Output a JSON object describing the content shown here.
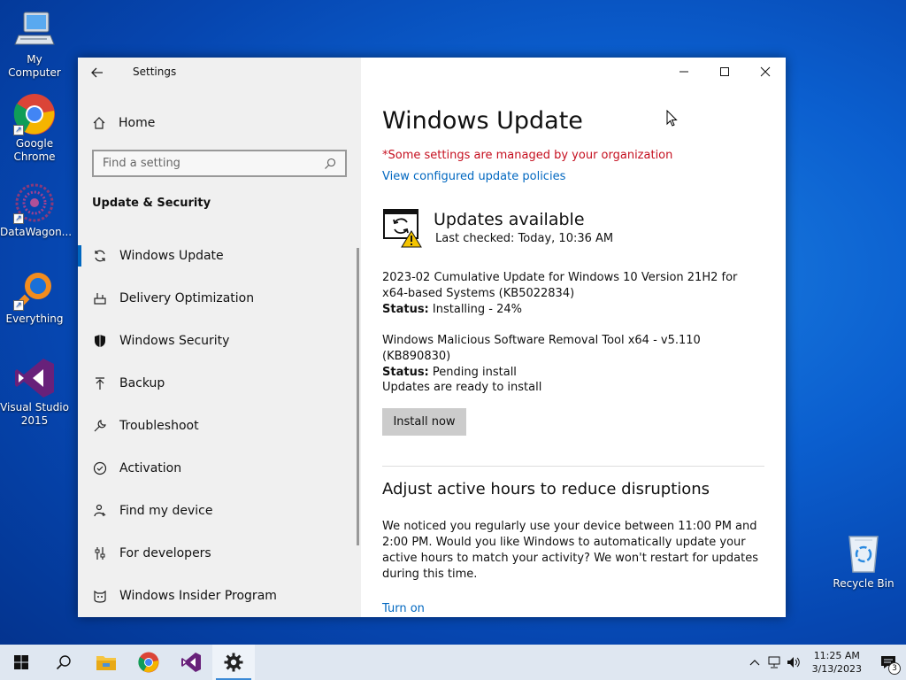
{
  "desktop": {
    "icons": [
      {
        "label": "My Computer",
        "icon": "computer-icon"
      },
      {
        "label": "Google Chrome",
        "icon": "chrome-icon"
      },
      {
        "label": "DataWagon...",
        "icon": "datawagon-icon"
      },
      {
        "label": "Everything",
        "icon": "everything-icon"
      },
      {
        "label": "Visual Studio 2015",
        "icon": "visual-studio-icon"
      }
    ],
    "recycle_bin": "Recycle Bin"
  },
  "window": {
    "app_title": "Settings",
    "sidebar": {
      "home_label": "Home",
      "search_placeholder": "Find a setting",
      "section_title": "Update & Security",
      "items": [
        {
          "label": "Windows Update",
          "icon": "sync-icon",
          "active": true
        },
        {
          "label": "Delivery Optimization",
          "icon": "delivery-optimization-icon"
        },
        {
          "label": "Windows Security",
          "icon": "shield-icon"
        },
        {
          "label": "Backup",
          "icon": "backup-arrow-icon"
        },
        {
          "label": "Troubleshoot",
          "icon": "wrench-icon"
        },
        {
          "label": "Activation",
          "icon": "checkmark-circle-icon"
        },
        {
          "label": "Find my device",
          "icon": "person-location-icon"
        },
        {
          "label": "For developers",
          "icon": "developer-sliders-icon"
        },
        {
          "label": "Windows Insider Program",
          "icon": "insider-cat-icon"
        }
      ]
    },
    "main": {
      "title": "Windows Update",
      "managed_notice": "*Some settings are managed by your organization",
      "policies_link": "View configured update policies",
      "status_title": "Updates available",
      "last_checked": "Last checked: Today, 10:36 AM",
      "updates": [
        {
          "name": "2023-02 Cumulative Update for Windows 10 Version 21H2 for x64-based Systems (KB5022834)",
          "status_label": "Status:",
          "status": "Installing - 24%"
        },
        {
          "name": "Windows Malicious Software Removal Tool x64 - v5.110 (KB890830)",
          "status_label": "Status:",
          "status": "Pending install"
        }
      ],
      "ready_text": "Updates are ready to install",
      "install_button": "Install now",
      "active_hours_title": "Adjust active hours to reduce disruptions",
      "active_hours_text": "We noticed you regularly use your device between 11:00 PM and 2:00 PM. Would you like Windows to automatically update your active hours to match your activity? We won't restart for updates during this time.",
      "turn_on_link": "Turn on"
    }
  },
  "taskbar": {
    "time": "11:25 AM",
    "date": "3/13/2023",
    "notification_count": "3"
  },
  "colors": {
    "accent": "#0067c0",
    "warning_text": "#c50f1f",
    "sidebar_bg": "#f0f0f0",
    "taskbar_bg": "#dfe7f1"
  }
}
